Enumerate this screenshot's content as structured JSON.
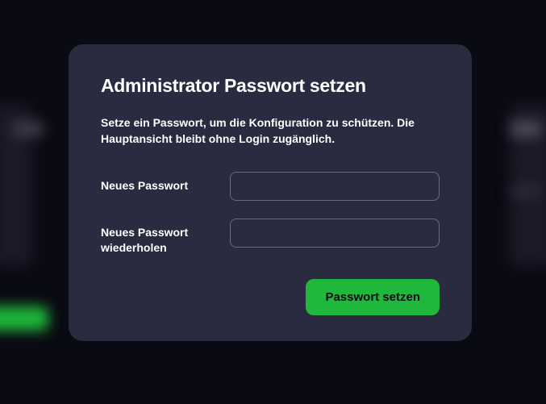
{
  "modal": {
    "title": "Administrator Passwort setzen",
    "description": "Setze ein Passwort, um die Konfiguration zu schützen. Die Hauptansicht bleibt ohne Login zugänglich.",
    "fields": {
      "new_password": {
        "label": "Neues Passwort",
        "value": ""
      },
      "repeat_password": {
        "label": "Neues Passwort wiederholen",
        "value": ""
      }
    },
    "submit_label": "Passwort setzen"
  },
  "colors": {
    "modal_bg": "#2a2a40",
    "accent": "#1fb83c",
    "page_bg": "#0a0a12"
  }
}
